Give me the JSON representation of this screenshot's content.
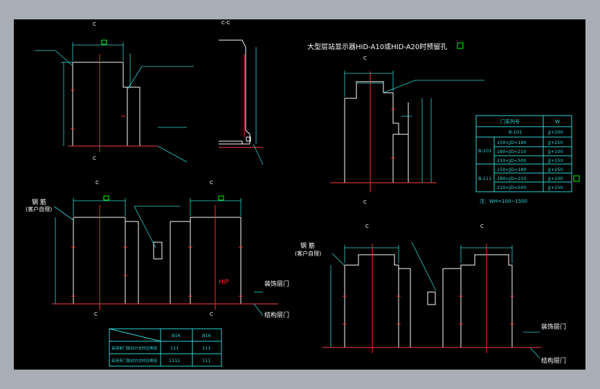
{
  "title": "大型层站显示器HID-A10或HID-A20时预留孔",
  "title_marker": "□",
  "section_label": "C-C",
  "section_marks": [
    "C",
    "C",
    "C",
    "C",
    "C",
    "C",
    "C",
    "C",
    "C",
    "C"
  ],
  "labels": {
    "rebar": "钢 筋",
    "customer_provided": "(客户自理)",
    "rebar_2": "钢 筋",
    "customer_provided_2": "(客户自理)",
    "finished_floor_1": "装饰层门",
    "structural_floor_1": "结构层门",
    "finished_floor_2": "装饰层门",
    "structural_floor_2": "结构层门",
    "hip": "HIP",
    "note_wh": "注：WH=100~1500"
  },
  "spec_table": {
    "headers": [
      "门系列号",
      "W"
    ],
    "rows": [
      {
        "group": "",
        "sub": "B-101",
        "w": "JJ+200"
      },
      {
        "group": "B-101",
        "sub": "150<JD<180",
        "w": "JJ+250"
      },
      {
        "group": "",
        "sub": "180<JD<210",
        "w": "JJ+100"
      },
      {
        "group": "",
        "sub": "210<JD<500",
        "w": "JJ+150"
      },
      {
        "group": "B-111",
        "sub": "150<JD<180",
        "w": "JJ+250"
      },
      {
        "group": "",
        "sub": "180<JD<210",
        "w": "JJ+100"
      },
      {
        "group": "",
        "sub": "210<JD<500",
        "w": "JJ+150"
      }
    ]
  },
  "bottom_table": {
    "headers": [
      "B16",
      "B16"
    ],
    "rows": [
      {
        "label": "采用单门驱动方式时召唤钮",
        "a": "111",
        "b": "111"
      },
      {
        "label": "采用多门驱动方式时召唤钮",
        "a": "1111",
        "b": "111"
      }
    ]
  },
  "colors": {
    "line": "#ffffff",
    "dim": "#2fd8d8",
    "center": "#ff2a2a",
    "floor": "#ff4040",
    "marker": "#00ff00",
    "background": "#000000"
  }
}
